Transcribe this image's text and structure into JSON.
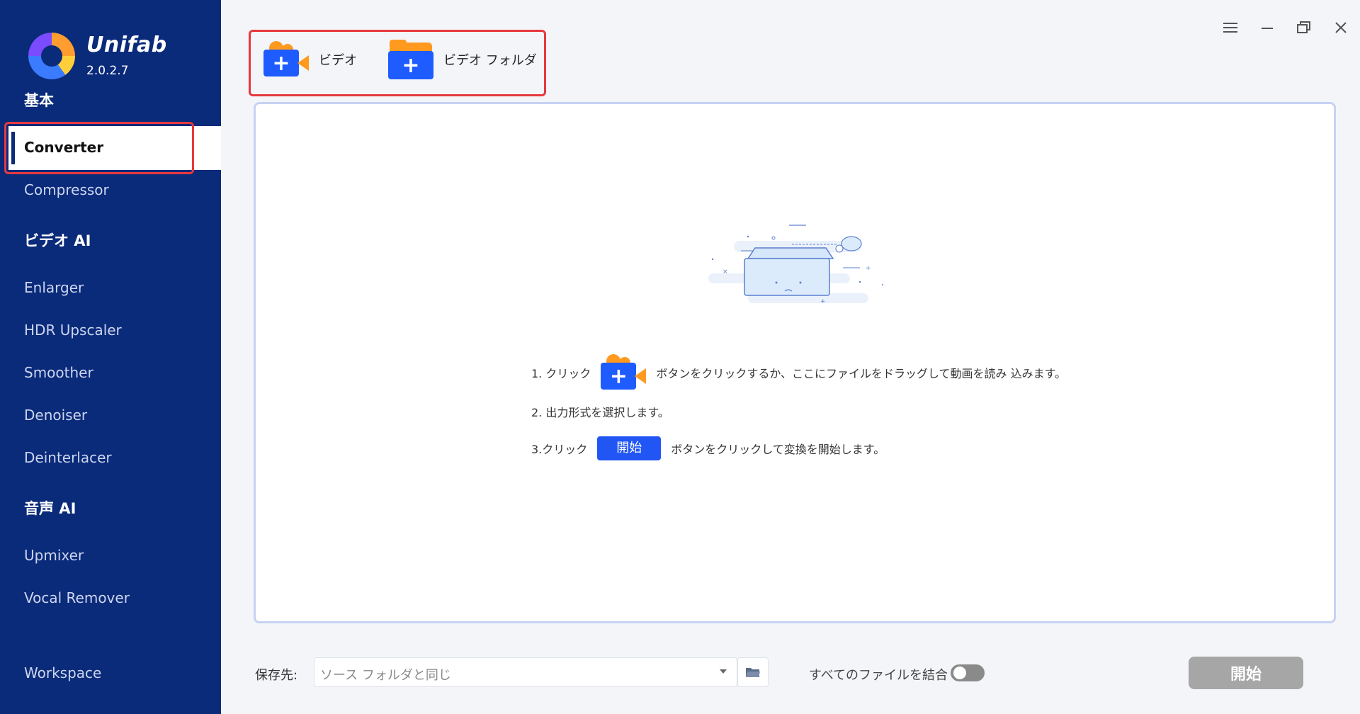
{
  "app": {
    "name": "Unifab",
    "version": "2.0.2.7"
  },
  "sidebar": {
    "section_basic": "基本",
    "active_item": "Converter",
    "items_basic": [
      "Compressor"
    ],
    "section_video_ai": "ビデオ AI",
    "items_video_ai": [
      "Enlarger",
      "HDR Upscaler",
      "Smoother",
      "Denoiser",
      "Deinterlacer"
    ],
    "section_audio_ai": "音声 AI",
    "items_audio_ai": [
      "Upmixer",
      "Vocal Remover"
    ],
    "workspace": "Workspace"
  },
  "toolbar": {
    "add_video_label": "ビデオ",
    "add_folder_label": "ビデオ フォルダ"
  },
  "instructions": {
    "step1_prefix": "1. クリック",
    "step1_suffix": "ボタンをクリックするか、ここにファイルをドラッグして動画を読み 込みます。",
    "step2": "2. 出力形式を選択します。",
    "step3_prefix": "3.クリック",
    "step3_button": "開始",
    "step3_suffix": "ボタンをクリックして変換を開始します。"
  },
  "bottom": {
    "save_to_label": "保存先:",
    "save_to_value": "ソース フォルダと同じ",
    "merge_label": "すべてのファイルを結合",
    "merge_enabled": false,
    "start_button": "開始"
  },
  "colors": {
    "sidebar_bg": "#0a2a7a",
    "accent": "#2156f5",
    "highlight": "#e6393f"
  }
}
